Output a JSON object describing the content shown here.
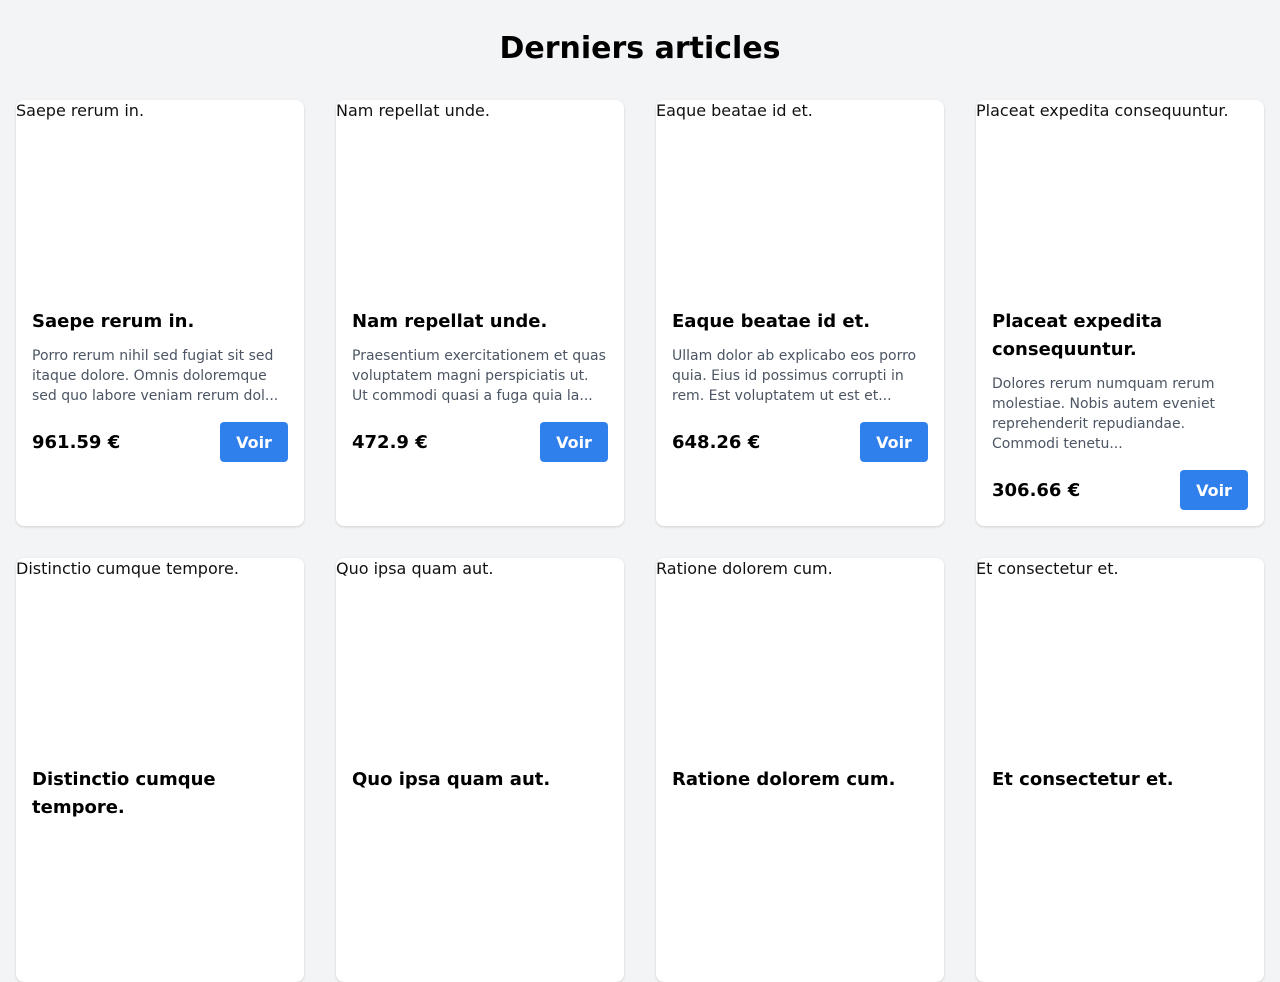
{
  "page": {
    "title": "Derniers articles"
  },
  "colors": {
    "background": "#f3f4f6",
    "card": "#ffffff",
    "button": "#2f80ed",
    "description": "#4b5563"
  },
  "cards": [
    {
      "image_alt": "Saepe rerum in.",
      "title": "Saepe rerum in.",
      "description": "Porro rerum nihil sed fugiat sit sed itaque dolore. Omnis doloremque sed quo labore veniam rerum dol...",
      "price": "961.59 €",
      "button_label": "Voir"
    },
    {
      "image_alt": "Nam repellat unde.",
      "title": "Nam repellat unde.",
      "description": "Praesentium exercitationem et quas voluptatem magni perspiciatis ut. Ut commodi quasi a fuga quia la...",
      "price": "472.9 €",
      "button_label": "Voir"
    },
    {
      "image_alt": "Eaque beatae id et.",
      "title": "Eaque beatae id et.",
      "description": "Ullam dolor ab explicabo eos porro quia. Eius id possimus corrupti in rem. Est voluptatem ut est et...",
      "price": "648.26 €",
      "button_label": "Voir"
    },
    {
      "image_alt": "Placeat expedita consequuntur.",
      "title": "Placeat expedita consequuntur.",
      "description": "Dolores rerum numquam rerum molestiae. Nobis autem eveniet reprehenderit repudiandae. Commodi tenetu...",
      "price": "306.66 €",
      "button_label": "Voir"
    },
    {
      "image_alt": "Distinctio cumque tempore.",
      "title": "Distinctio cumque tempore.",
      "description": "",
      "price": "",
      "button_label": ""
    },
    {
      "image_alt": "Quo ipsa quam aut.",
      "title": "Quo ipsa quam aut.",
      "description": "",
      "price": "",
      "button_label": ""
    },
    {
      "image_alt": "Ratione dolorem cum.",
      "title": "Ratione dolorem cum.",
      "description": "",
      "price": "",
      "button_label": ""
    },
    {
      "image_alt": "Et consectetur et.",
      "title": "Et consectetur et.",
      "description": "",
      "price": "",
      "button_label": ""
    }
  ]
}
